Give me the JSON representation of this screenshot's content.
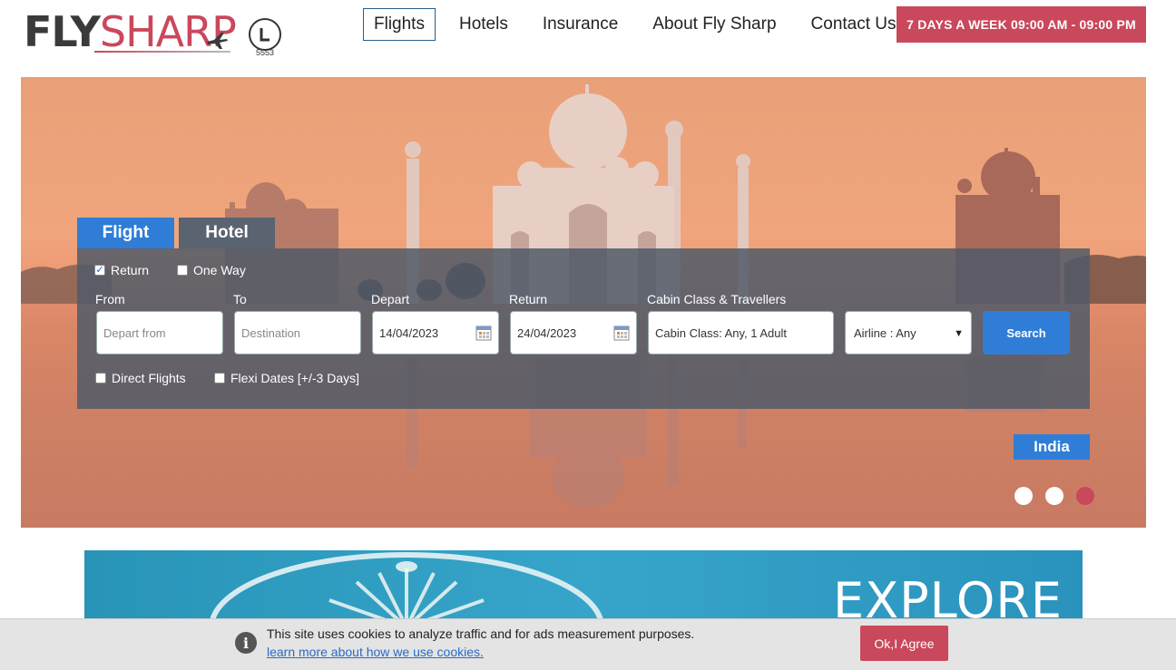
{
  "brand": {
    "fly": "FLY",
    "sharp": "SHARP",
    "atol_number": "5553"
  },
  "nav": {
    "items": [
      {
        "label": "Flights",
        "active": true
      },
      {
        "label": "Hotels"
      },
      {
        "label": "Insurance"
      },
      {
        "label": "About Fly Sharp"
      },
      {
        "label": "Contact Us"
      }
    ],
    "hours": "7 DAYS A WEEK 09:00 AM - 09:00 PM"
  },
  "search": {
    "tabs": [
      "Flight",
      "Hotel"
    ],
    "trip_types": [
      {
        "label": "Return",
        "checked": true
      },
      {
        "label": "One Way",
        "checked": false
      }
    ],
    "labels": {
      "from": "From",
      "to": "To",
      "depart": "Depart",
      "return": "Return",
      "cabin": "Cabin Class & Travellers"
    },
    "from_placeholder": "Depart from",
    "to_placeholder": "Destination",
    "depart_date": "14/04/2023",
    "return_date": "24/04/2023",
    "cabin_value": "Cabin Class: Any, 1 Adult",
    "airline_value": "Airline : Any",
    "search_label": "Search",
    "options": [
      {
        "label": "Direct Flights",
        "checked": false
      },
      {
        "label": "Flexi Dates [+/-3 Days]",
        "checked": false
      }
    ]
  },
  "hero": {
    "destination": "India",
    "slides": [
      {
        "active": false
      },
      {
        "active": false
      },
      {
        "active": true
      }
    ]
  },
  "banner": {
    "title": "EXPLORE"
  },
  "cookie": {
    "message": "This site uses cookies to analyze traffic and for ads measurement purposes.",
    "link": "learn more about how we use cookies.",
    "button": "Ok,I Agree"
  },
  "colors": {
    "accent": "#c9485b",
    "primary": "#2f7dd6"
  }
}
